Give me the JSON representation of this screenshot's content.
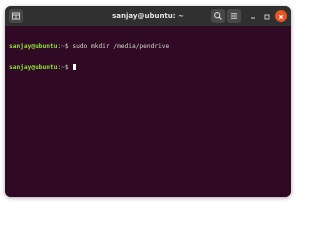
{
  "window": {
    "title": "sanjay@ubuntu: ~",
    "icons": {
      "new_tab": "new-tab-icon",
      "search": "search-icon",
      "menu": "hamburger-menu-icon",
      "minimize": "minimize-icon",
      "maximize": "maximize-icon",
      "close": "close-icon"
    }
  },
  "terminal": {
    "lines": [
      {
        "user_host": "sanjay@ubuntu",
        "separator": ":",
        "path": "~",
        "prompt_symbol": "$",
        "command": "sudo mkdir /media/pendrive"
      },
      {
        "user_host": "sanjay@ubuntu",
        "separator": ":",
        "path": "~",
        "prompt_symbol": "$",
        "command": ""
      }
    ]
  },
  "colors": {
    "terminal_background": "#300a24",
    "titlebar_background": "#303030",
    "prompt_user": "#8ae234",
    "prompt_path": "#729fcf",
    "text": "#d3d7cf",
    "close_button": "#e95420"
  }
}
